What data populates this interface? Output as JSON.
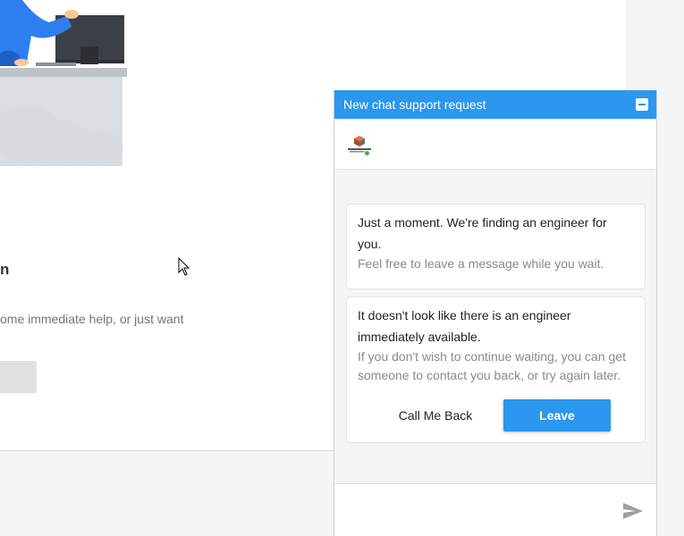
{
  "background": {
    "heading": "n",
    "text": "ome immediate help, or just want"
  },
  "chat": {
    "header_title": "New chat support request",
    "brand_logo_icon": "tech-support-logo-icon",
    "brand_logo_text": "TechDirector",
    "online_status_color": "#3fae49",
    "accent_color": "#2b97ee",
    "messages": [
      {
        "title": "Just a moment. We're finding an engineer for you.",
        "subtitle": "Feel free to leave a message while you wait."
      },
      {
        "title": "It doesn't look like there is an engineer immediately available.",
        "subtitle": "If you don't wish to continue waiting, you can get someone to contact you back, or try again later."
      }
    ],
    "actions": {
      "call_back_label": "Call Me Back",
      "leave_label": "Leave"
    },
    "composer": {
      "placeholder": "",
      "send_icon": "send-icon"
    }
  }
}
